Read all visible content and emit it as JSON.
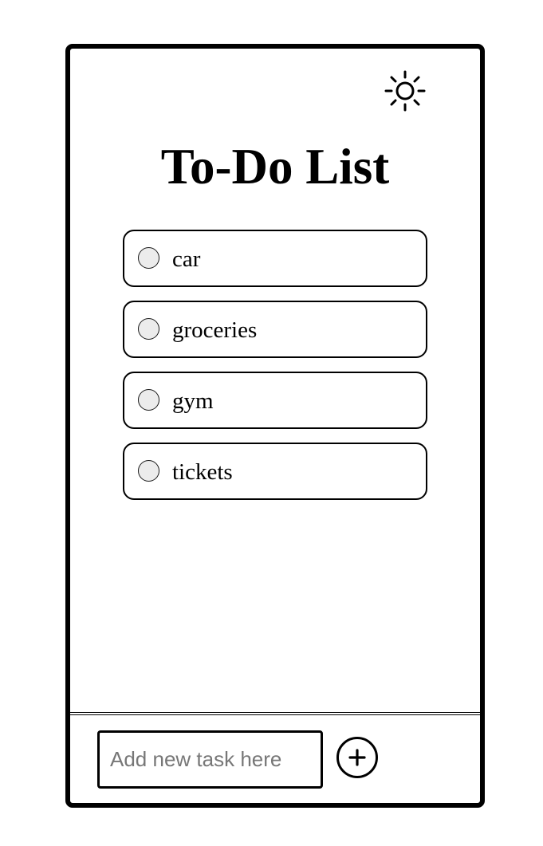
{
  "header": {
    "title": "To-Do List",
    "theme_toggle_icon": "sun-icon"
  },
  "tasks": [
    {
      "label": "car",
      "completed": false
    },
    {
      "label": "groceries",
      "completed": false
    },
    {
      "label": "gym",
      "completed": false
    },
    {
      "label": "tickets",
      "completed": false
    }
  ],
  "composer": {
    "input_placeholder": "Add new task here",
    "input_value": "",
    "add_icon": "plus-icon"
  },
  "colors": {
    "border": "#000000",
    "checkbox_fill": "#ececec",
    "placeholder": "#777777",
    "background": "#ffffff"
  }
}
